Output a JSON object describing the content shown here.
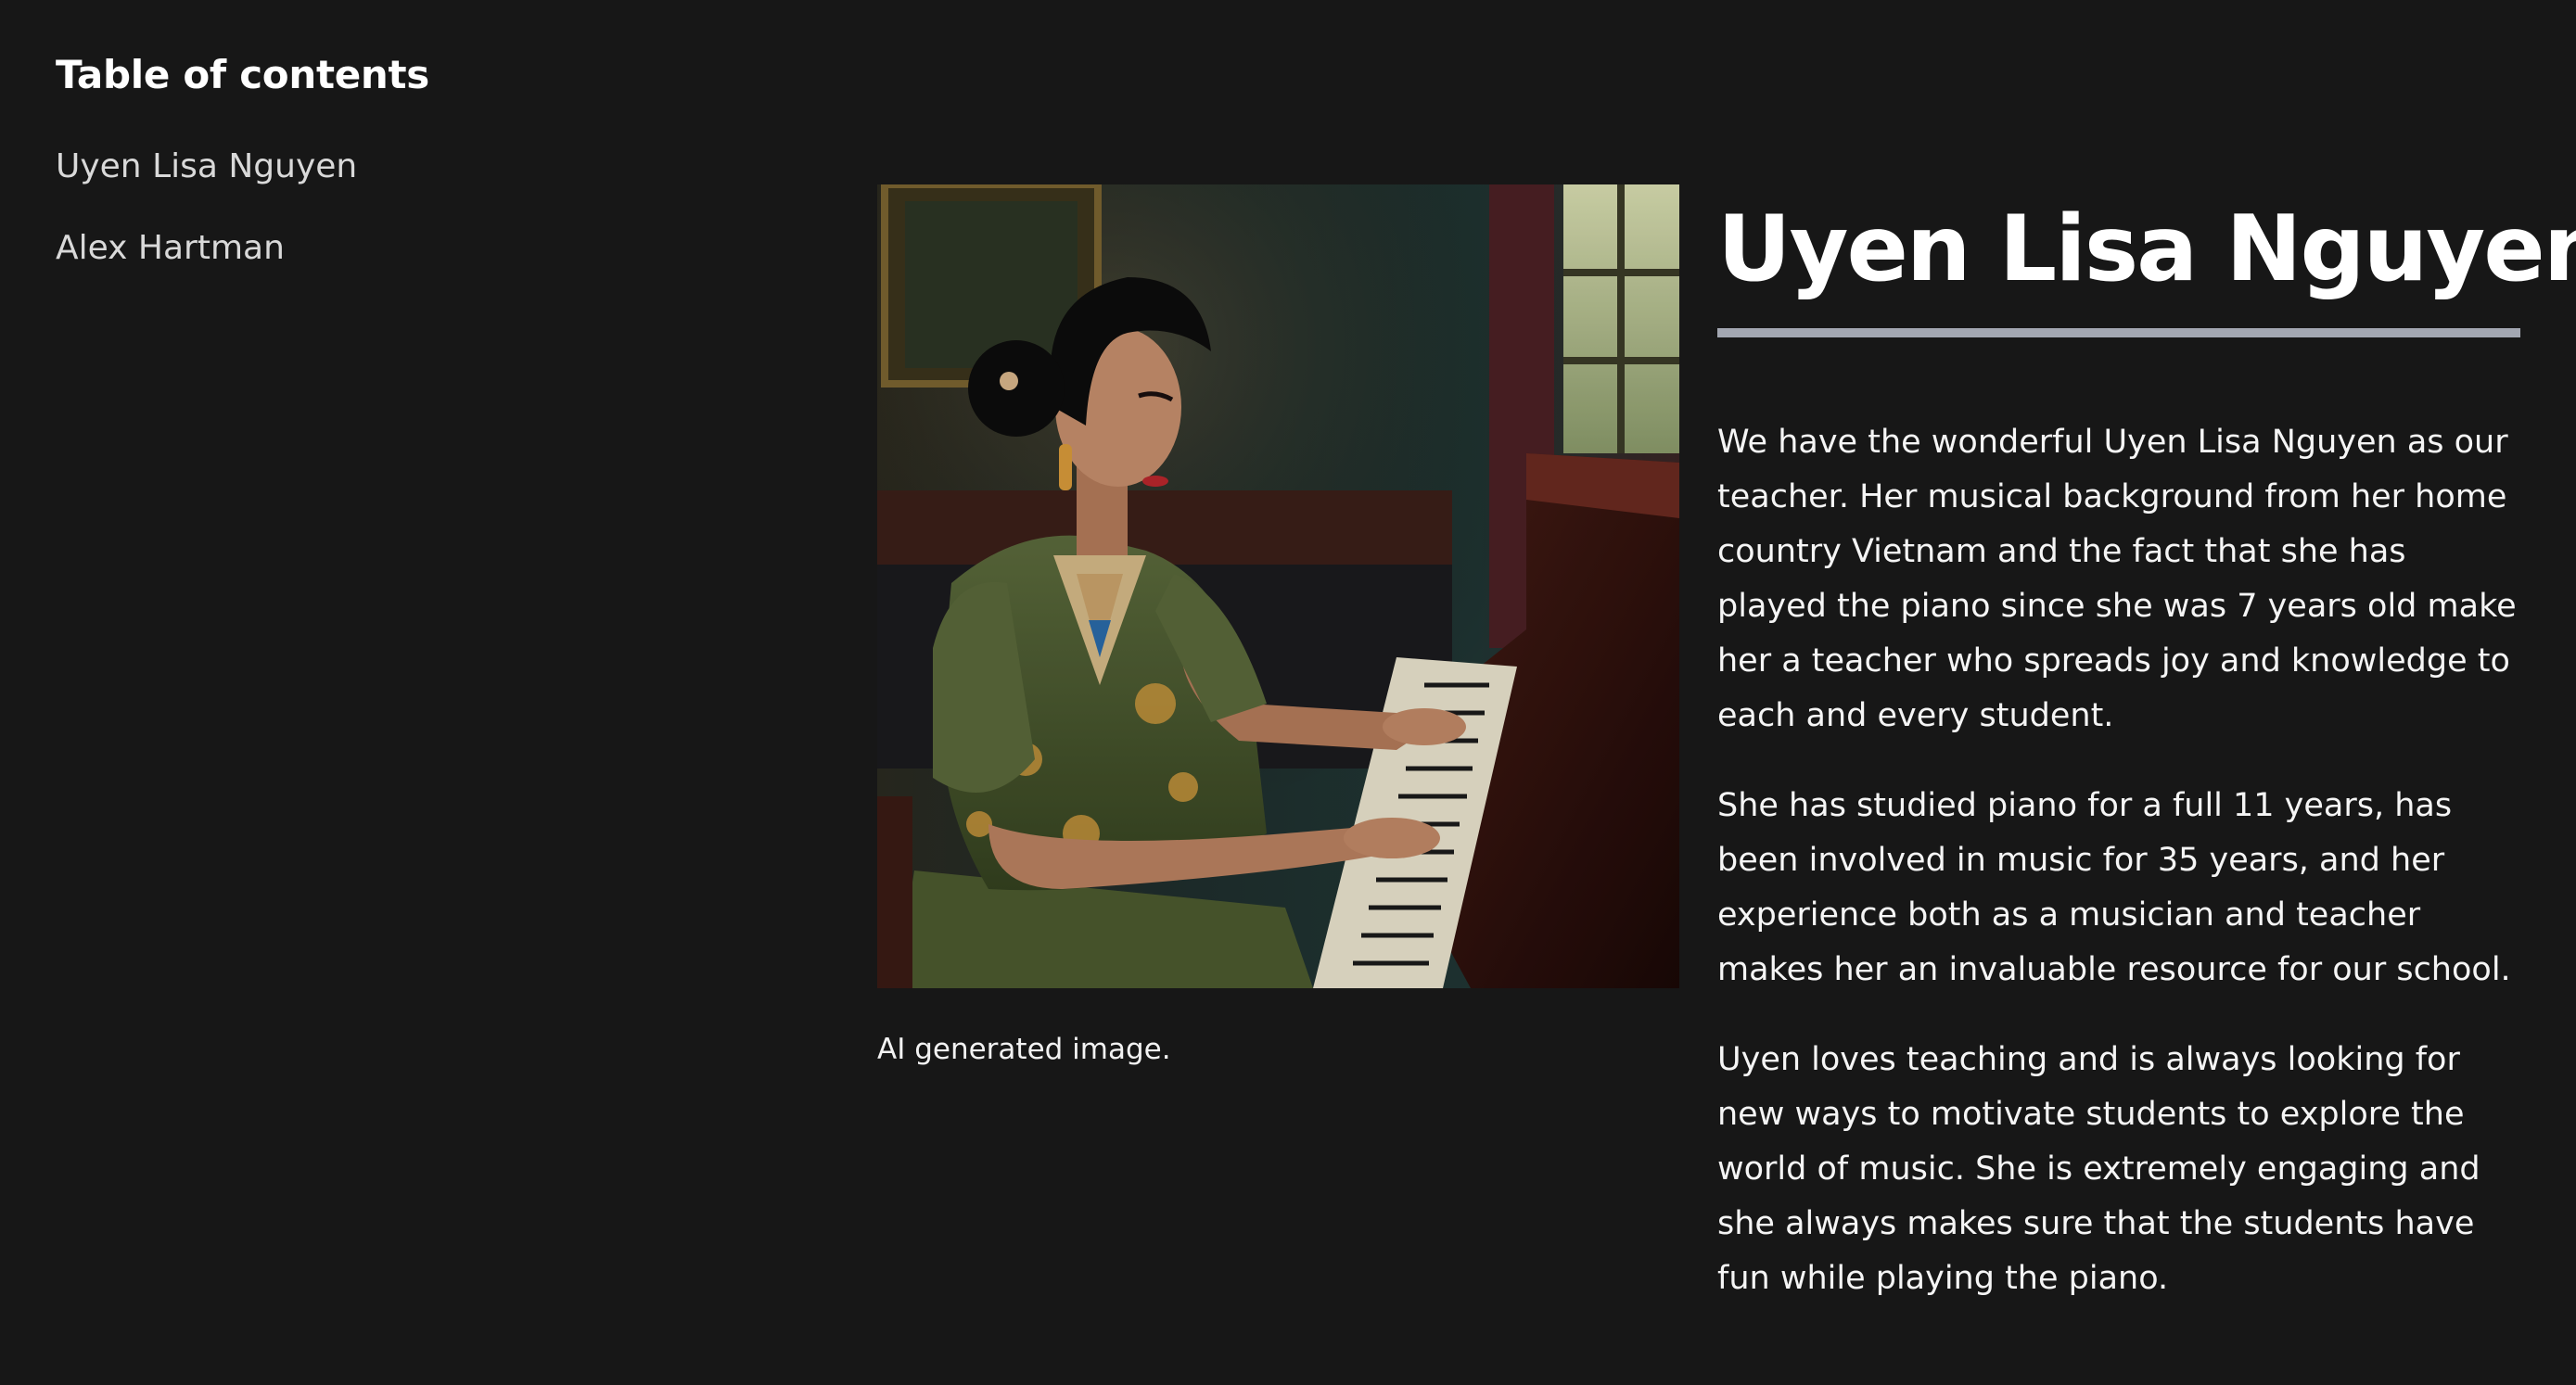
{
  "toc": {
    "title": "Table of contents",
    "items": [
      {
        "label": "Uyen Lisa Nguyen"
      },
      {
        "label": "Alex Hartman"
      }
    ]
  },
  "figure": {
    "caption": "AI generated image."
  },
  "article": {
    "heading": "Uyen Lisa Nguyen",
    "paragraphs": [
      "We have the wonderful Uyen Lisa Nguyen as our teacher. Her musical background from her home country Vietnam and the fact that she has played the piano since she was 7 years old make her a teacher who spreads joy and knowledge to each and every student.",
      "She has studied piano for a full 11 years, has been involved in music for 35 years, and her experience both as a musician and teacher makes her an invaluable resource for our school.",
      "Uyen loves teaching and is always looking for new ways to motivate students to explore the world of music. She is extremely engaging and she always makes sure that the students have fun while playing the piano."
    ]
  },
  "colors": {
    "background": "#171717",
    "text": "#ffffff",
    "toc_link": "#d9d9d9",
    "accent": "#a3a7b2"
  }
}
